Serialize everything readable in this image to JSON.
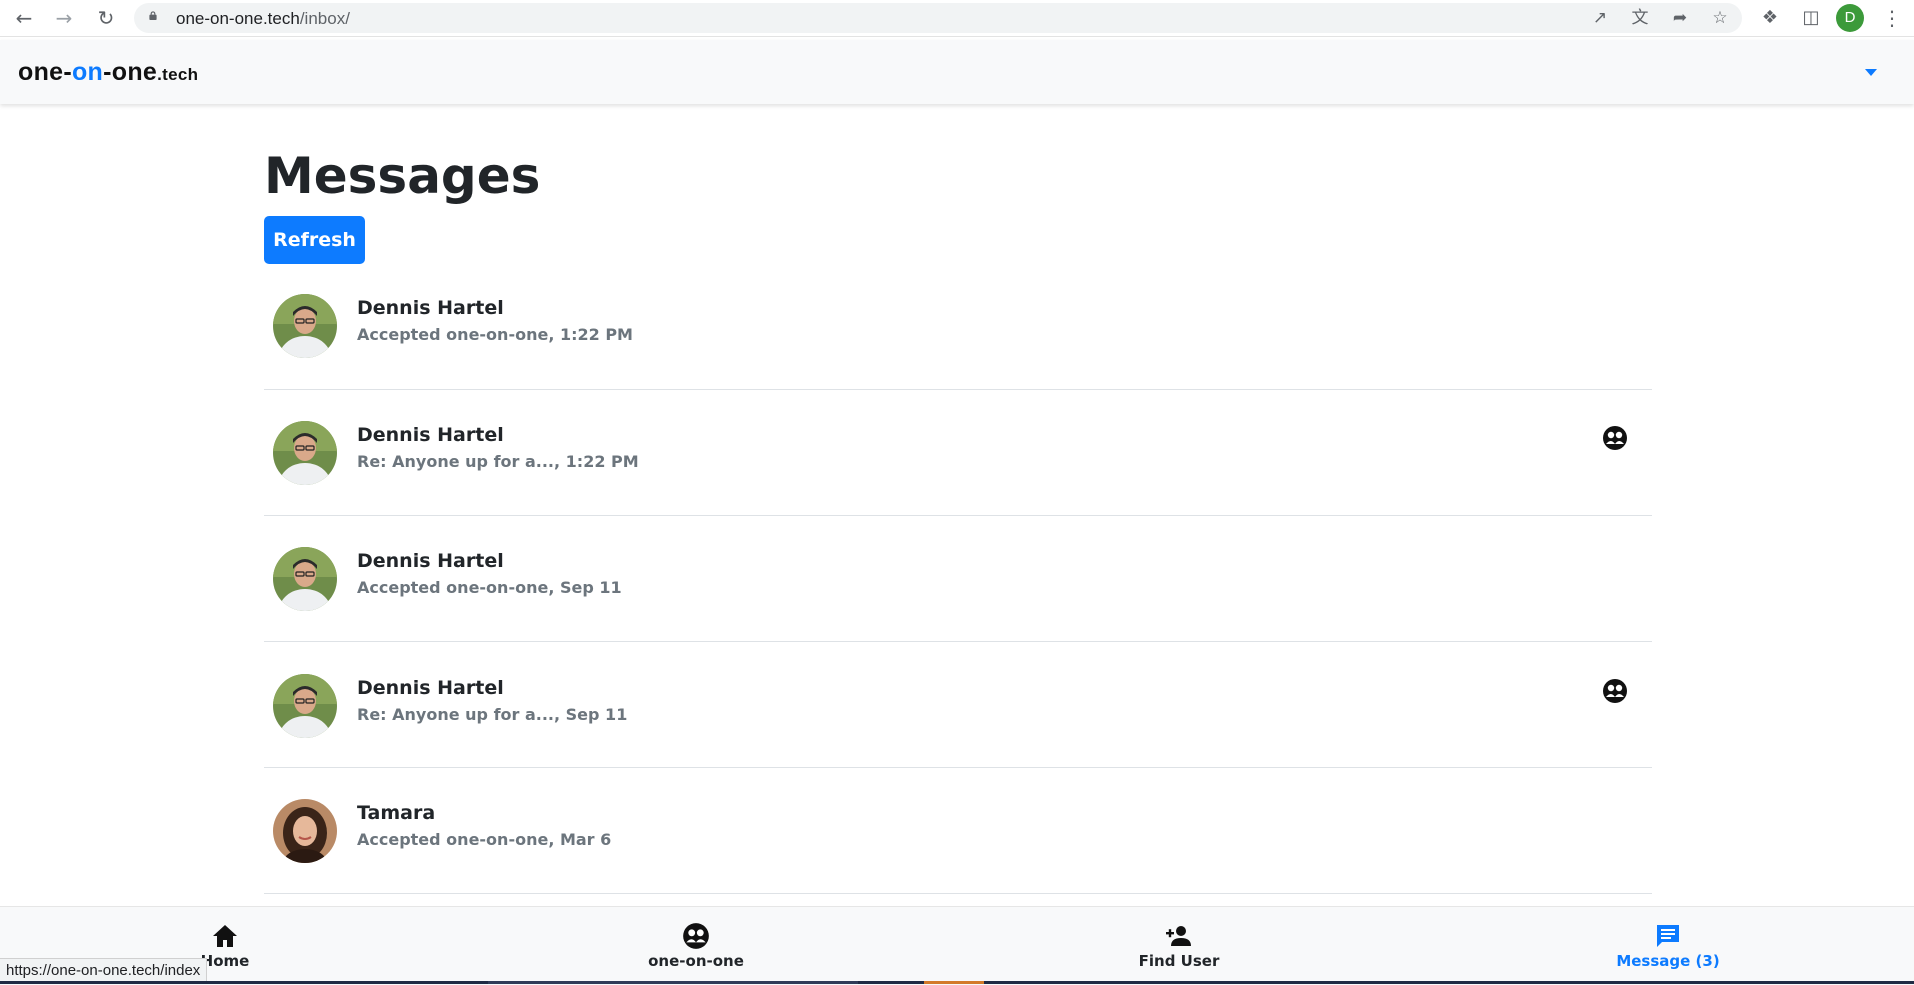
{
  "browser": {
    "url_host": "one-on-one.tech",
    "url_path": "/inbox/",
    "profile_initial": "D",
    "icons": [
      "back-icon",
      "forward-icon",
      "reload-icon",
      "lock-icon",
      "open-in-app-icon",
      "translate-icon",
      "share-icon",
      "bookmark-star-icon",
      "extensions-icon",
      "side-panel-icon",
      "menu-kebab-icon"
    ]
  },
  "navbar": {
    "brand_part1": "one-",
    "brand_part2": "on",
    "brand_part3": "-one",
    "brand_tld": ".tech",
    "accent_color": "#0d7bff"
  },
  "main": {
    "title": "Messages",
    "refresh_label": "Refresh",
    "messages": [
      {
        "name": "Dennis Hartel",
        "subtitle": "Accepted one-on-one, 1:22 PM",
        "has_badge": false
      },
      {
        "name": "Dennis Hartel",
        "subtitle": "Re: Anyone up for a..., 1:22 PM",
        "has_badge": true
      },
      {
        "name": "Dennis Hartel",
        "subtitle": "Accepted one-on-one, Sep 11",
        "has_badge": false
      },
      {
        "name": "Dennis Hartel",
        "subtitle": "Re: Anyone up for a..., Sep 11",
        "has_badge": true
      },
      {
        "name": "Tamara",
        "subtitle": "Accepted one-on-one, Mar 6",
        "has_badge": false
      }
    ]
  },
  "bottom_nav": {
    "home": "Home",
    "one_on_one": "one-on-one",
    "find_user": "Find User",
    "message": "Message (3)"
  },
  "status_bar_url": "https://one-on-one.tech/index"
}
